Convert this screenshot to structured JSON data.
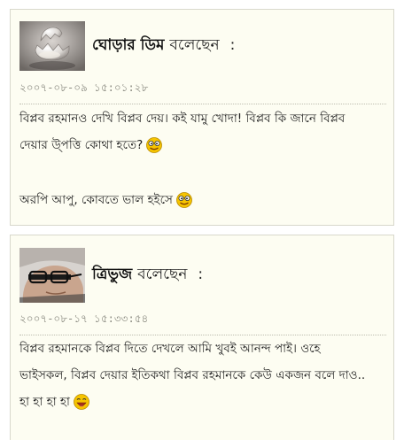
{
  "comments": [
    {
      "author": "ঘোড়ার ডিম",
      "said": "বলেছেন",
      "colon": ":",
      "date": "২০০৭-০৮-০৯ ১৫:০১:২৮",
      "lines": [
        "বিপ্লব রহমানও দেখি বিপ্লব দেয়। কই যামু খোদা! বিপ্লব কি জানে বিপ্লব",
        "দেয়ার উ্পত্তি কোথা হতে?",
        "অরপি আপু, কোবতে ভাল হইসে"
      ],
      "avatar_icon": "egg-avatar",
      "smiley_icon": "cool-smiley-icon"
    },
    {
      "author": "ত্রিভুজ",
      "said": "বলেছেন",
      "colon": ":",
      "date": "২০০৭-০৮-১৭ ১৫:৩৩:৫৪",
      "lines": [
        "বিপ্লব রহমানকে বিপ্লব দিতে দেখলে আমি খুবই আনন্দ পাই। ওহে",
        "ভাইসকল, বিপ্লব দেয়ার ইতিকথা বিপ্লব রহমানকে কেউ একজন বলে দাও..",
        "হা হা হা হা"
      ],
      "avatar_icon": "glasses-face-avatar",
      "smiley_icon": "laughing-smiley-icon"
    }
  ],
  "colors": {
    "card_bg": "#fdfdf2",
    "card_border": "#d8d8cc",
    "date_text": "#8a8a80",
    "smiley_yellow": "#f6c400"
  }
}
